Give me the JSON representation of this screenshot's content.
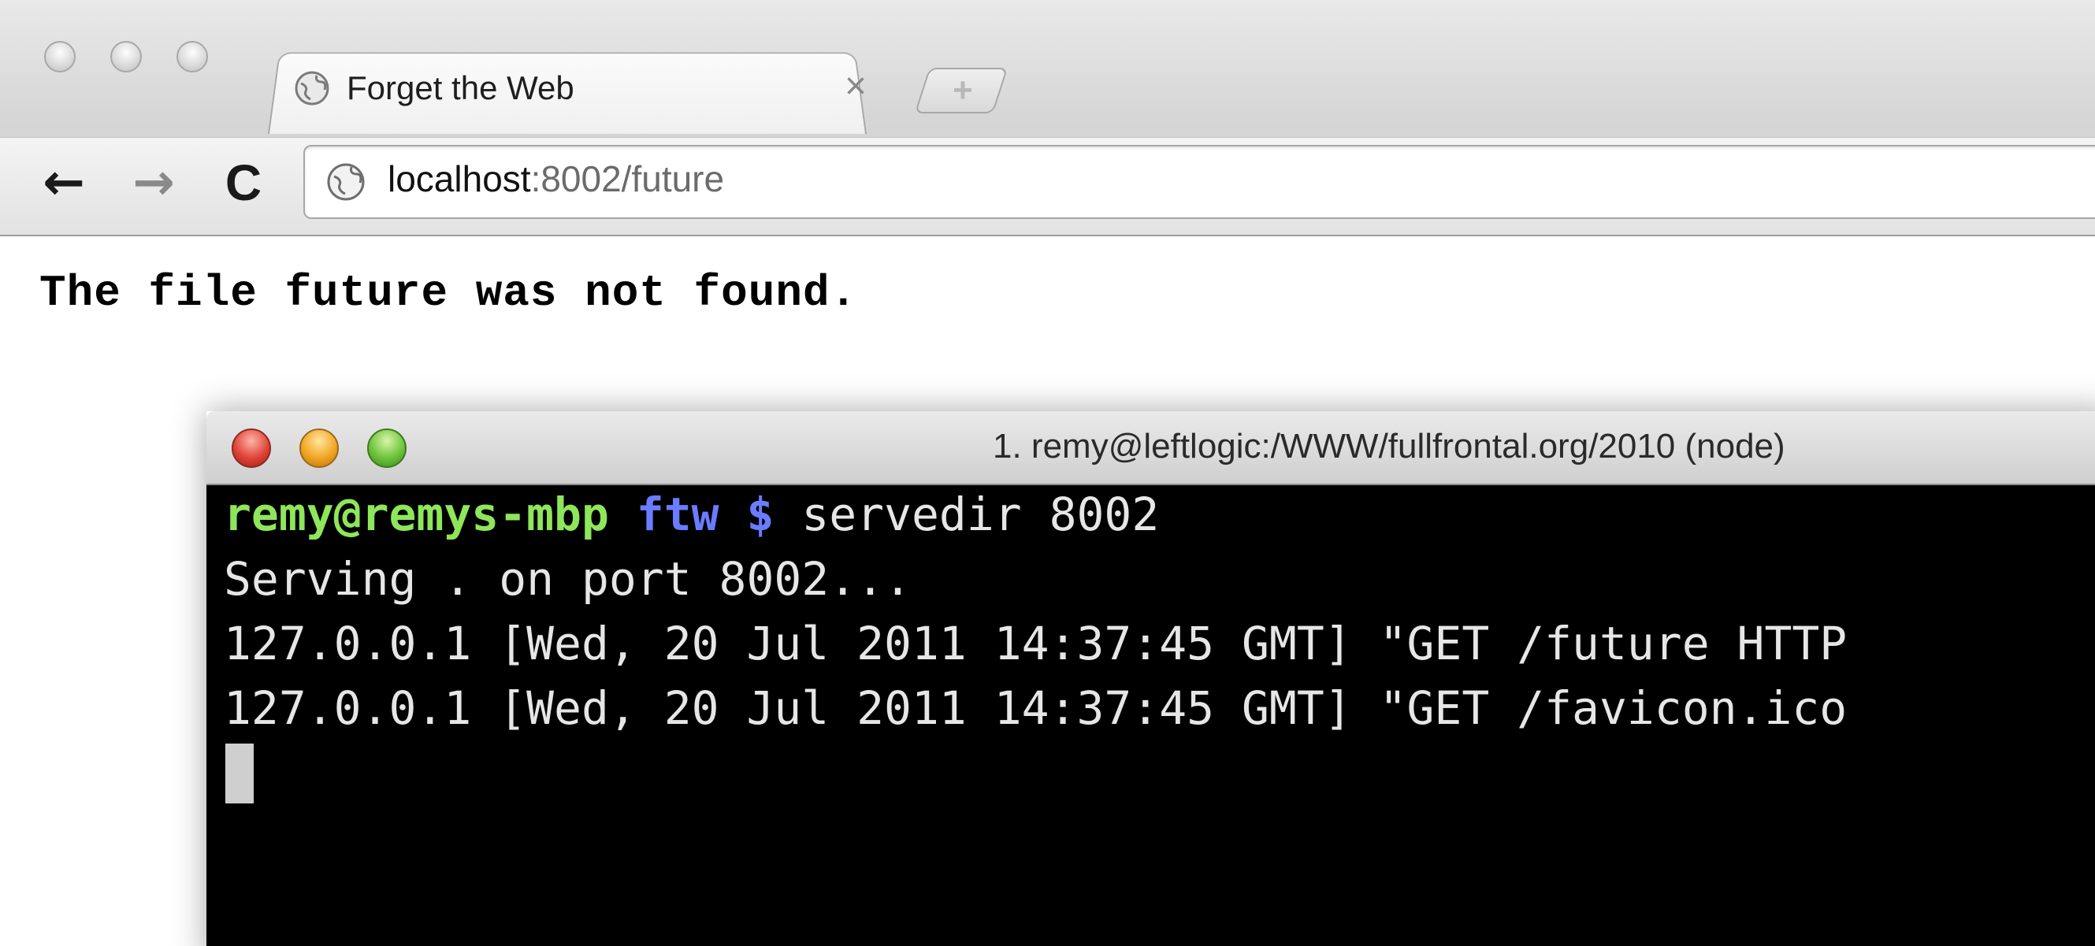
{
  "browser": {
    "tab": {
      "title": "Forget the Web",
      "close_glyph": "×",
      "favicon": "globe-icon"
    },
    "new_tab_glyph": "+",
    "nav": {
      "back_glyph": "←",
      "forward_glyph": "→",
      "reload_glyph": "C"
    },
    "address": {
      "host": "localhost",
      "rest": ":8002/future",
      "icon": "globe-icon"
    }
  },
  "page": {
    "message": "The file future was not found."
  },
  "terminal": {
    "title": "1. remy@leftlogic:/WWW/fullfrontal.org/2010 (node)",
    "prompt_user": "remy@remys-mbp",
    "prompt_dir": "ftw $",
    "command": "servedir 8002",
    "lines": [
      "Serving . on port 8002...",
      "127.0.0.1 [Wed, 20 Jul 2011 14:37:45 GMT] \"GET /future HTTP",
      "127.0.0.1 [Wed, 20 Jul 2011 14:37:45 GMT] \"GET /favicon.ico"
    ]
  },
  "colors": {
    "prompt_user": "#8ee65a",
    "prompt_dir": "#6a7cff",
    "terminal_bg": "#000000"
  }
}
